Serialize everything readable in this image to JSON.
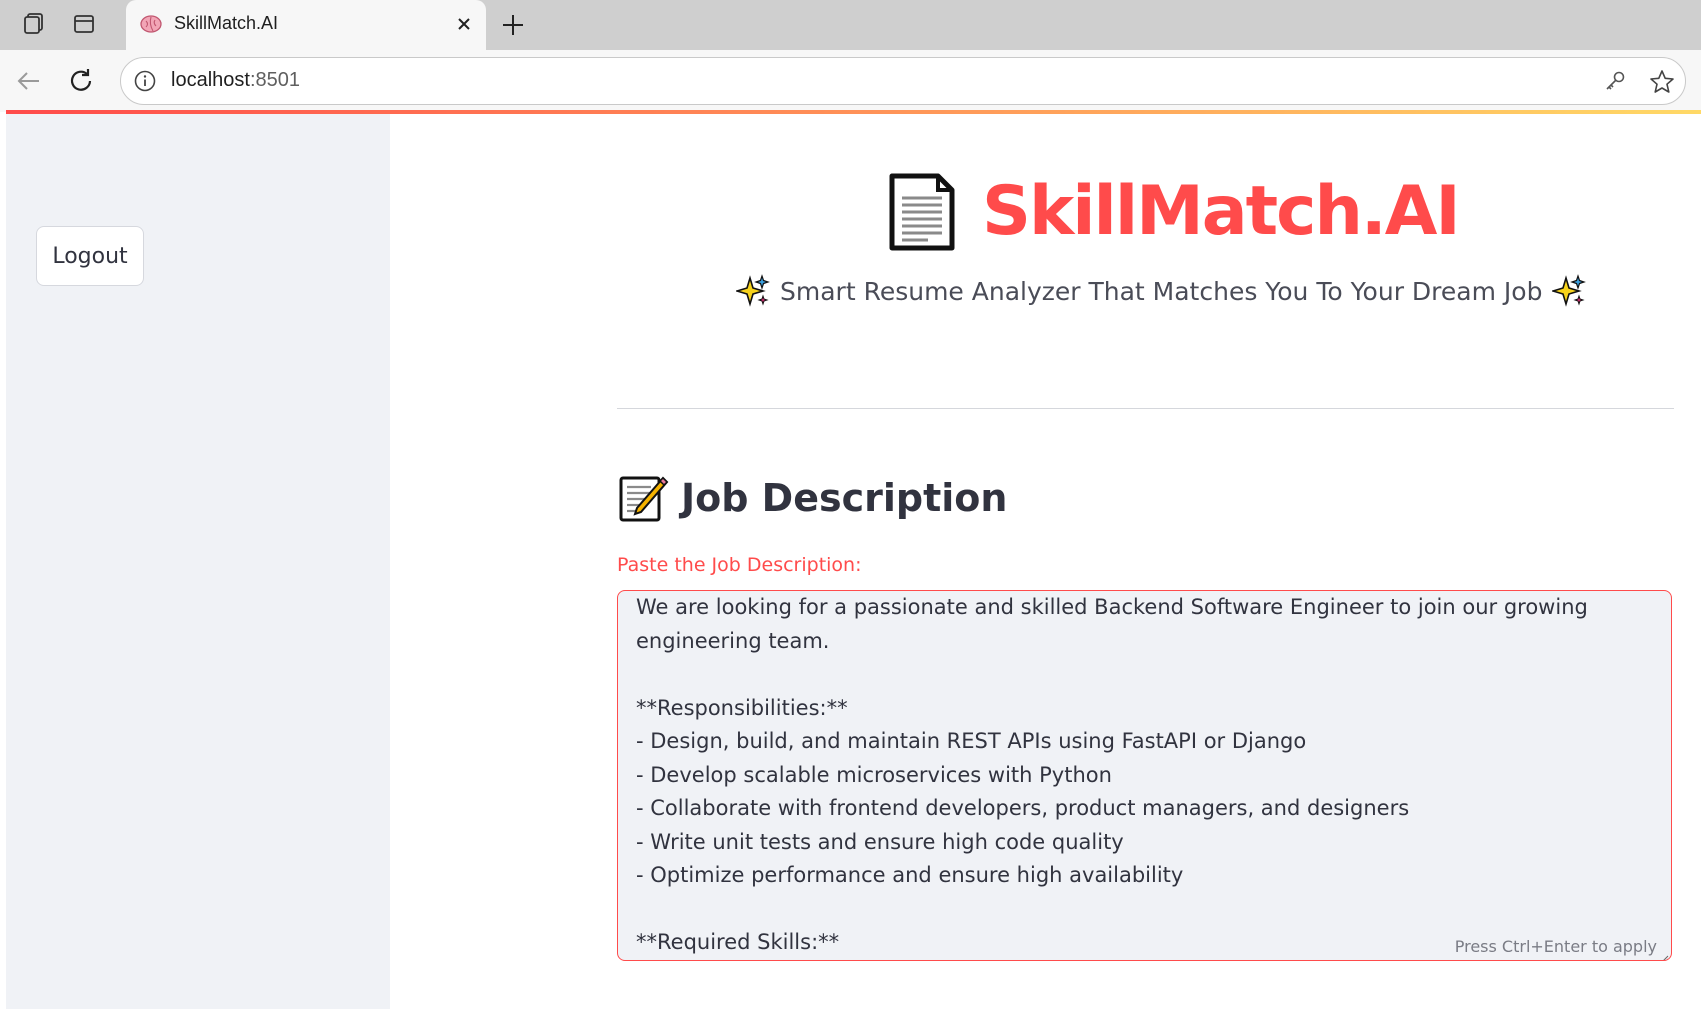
{
  "browser": {
    "tab_title": "SkillMatch.AI",
    "url_host": "localhost",
    "url_port": ":8501"
  },
  "sidebar": {
    "logout_label": "Logout"
  },
  "header": {
    "title": "SkillMatch.AI",
    "subtitle": "Smart Resume Analyzer That Matches You To Your Dream Job"
  },
  "job_section": {
    "heading": "Job Description",
    "field_label": "Paste the Job Description:",
    "textarea_value": "We are looking for a passionate and skilled Backend Software Engineer to join our growing engineering team.\n\n**Responsibilities:**\n- Design, build, and maintain REST APIs using FastAPI or Django\n- Develop scalable microservices with Python\n- Collaborate with frontend developers, product managers, and designers\n- Write unit tests and ensure high code quality\n- Optimize performance and ensure high availability\n\n**Required Skills:**",
    "hint": "Press Ctrl+Enter to apply"
  },
  "colors": {
    "accent": "#ff4b4b",
    "sidebar_bg": "#f0f2f6",
    "text": "#31333f"
  },
  "icons": [
    "workspaces-icon",
    "tab-actions-icon",
    "brain-favicon-icon",
    "close-icon",
    "plus-icon",
    "back-icon",
    "reload-icon",
    "info-icon",
    "key-icon",
    "star-icon",
    "document-icon",
    "sparkles-icon",
    "memo-icon"
  ]
}
